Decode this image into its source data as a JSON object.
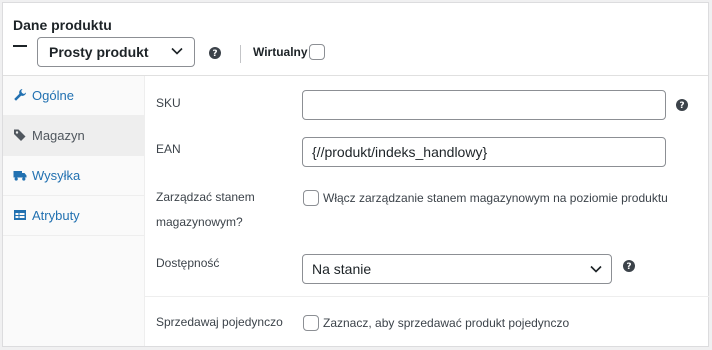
{
  "panel": {
    "title": "Dane produktu",
    "product_type": "Prosty produkt",
    "virtual_label": "Wirtualny"
  },
  "tabs": [
    {
      "label": "Ogólne",
      "icon": "wrench-icon"
    },
    {
      "label": "Magazyn",
      "icon": "tag-icon"
    },
    {
      "label": "Wysyłka",
      "icon": "truck-icon"
    },
    {
      "label": "Atrybuty",
      "icon": "table-icon"
    }
  ],
  "inventory": {
    "sku_label": "SKU",
    "sku_value": "",
    "ean_label": "EAN",
    "ean_value": "{//produkt/indeks_handlowy}",
    "manage_stock_label_1": "Zarządzać stanem",
    "manage_stock_label_2": "magazynowym?",
    "manage_stock_text": "Włącz zarządzanie stanem magazynowym na poziomie produktu",
    "availability_label": "Dostępność",
    "availability_value": "Na stanie",
    "sold_individually_label": "Sprzedawaj pojedynczo",
    "sold_individually_text": "Zaznacz, aby sprzedawać produkt pojedynczo"
  },
  "colors": {
    "link": "#2271b1",
    "active_tab_bg": "#eeeeee",
    "border": "#8c8f94"
  }
}
